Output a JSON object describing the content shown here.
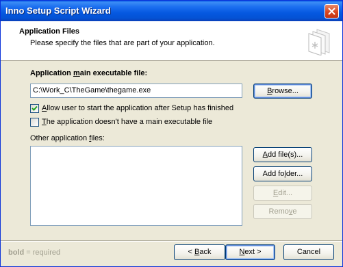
{
  "window": {
    "title": "Inno Setup Script Wizard"
  },
  "header": {
    "title": "Application Files",
    "subtitle": "Please specify the files that are part of your application."
  },
  "main_exe": {
    "label_before": "Application ",
    "label_mnemonic": "m",
    "label_after": "ain executable file:",
    "value": "C:\\Work_C\\TheGame\\thegame.exe",
    "browse_mnemonic": "B",
    "browse_rest": "rowse..."
  },
  "options": {
    "allow_start": {
      "mnemonic": "A",
      "rest": "llow user to start the application after Setup has finished",
      "checked": true
    },
    "no_main_exe": {
      "mnemonic": "T",
      "rest": "he application doesn't have a main executable file",
      "checked": false
    }
  },
  "other_files": {
    "label_before": "Other application ",
    "label_mnemonic": "f",
    "label_after": "iles:",
    "add_files_mnemonic": "A",
    "add_files_rest": "dd file(s)...",
    "add_folder_before": "Add fo",
    "add_folder_mnemonic": "l",
    "add_folder_after": "der...",
    "edit_mnemonic": "E",
    "edit_rest": "dit...",
    "remove_before": "Remo",
    "remove_mnemonic": "v",
    "remove_after": "e"
  },
  "footer": {
    "note_bold": "bold",
    "note_rest": " = required",
    "back_prefix": "< ",
    "back_mnemonic": "B",
    "back_rest": "ack",
    "next_mnemonic": "N",
    "next_rest": "ext >",
    "cancel": "Cancel"
  },
  "colors": {
    "titlebar": "#0558e0",
    "close_button": "#d8461f",
    "dialog_bg": "#ece9d8"
  },
  "icons": {
    "close": "close-icon",
    "header": "wizard-pages-icon",
    "check": "checkmark-icon"
  }
}
